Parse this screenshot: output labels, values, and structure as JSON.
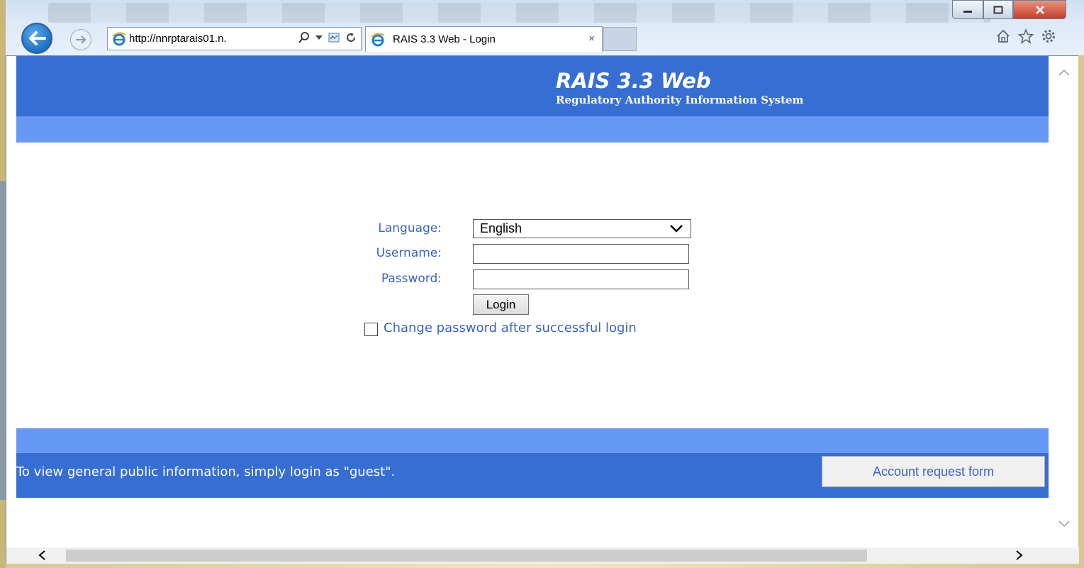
{
  "browser": {
    "url": "http://nnrptarais01.n.",
    "tab_title": "RAIS 3.3 Web - Login",
    "tab_close": "×"
  },
  "app": {
    "title": "RAIS 3.3 Web",
    "subtitle": "Regulatory Authority Information System"
  },
  "form": {
    "language_label": "Language:",
    "language_value": "English",
    "username_label": "Username:",
    "username_value": "",
    "password_label": "Password:",
    "password_value": "",
    "login_button": "Login",
    "change_password_label": "Change password after successful login",
    "change_password_checked": false
  },
  "footer": {
    "guest_text": "To view general public information, simply login as \"guest\".",
    "account_request_button": "Account request form"
  },
  "colors": {
    "header_dark": "#366ed3",
    "header_light": "#6699f6",
    "label_blue": "#3a64c8"
  }
}
